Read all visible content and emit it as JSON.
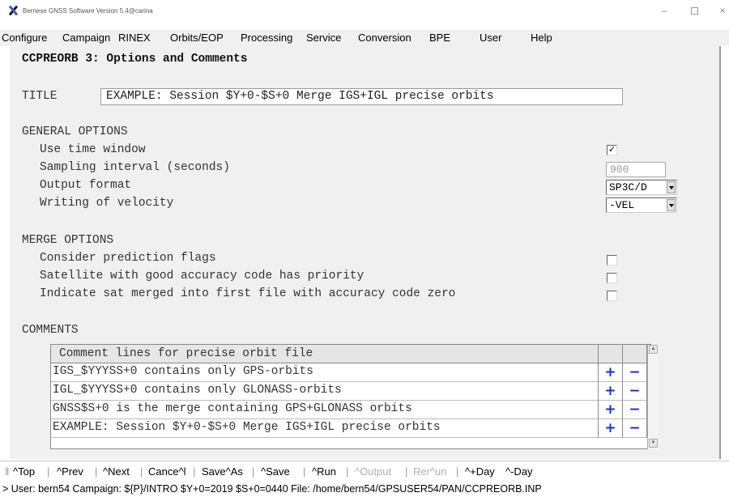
{
  "window": {
    "title": "Bernese GNSS Software Version 5.4@carina",
    "controls": {
      "minimize": "–",
      "maximize": "□",
      "close": "×"
    }
  },
  "menu": [
    "Configure",
    "Campaign",
    "RINEX",
    "Orbits/EOP",
    "Processing",
    "Service",
    "Conversion",
    "BPE",
    "User",
    "Help"
  ],
  "panel": {
    "heading": "CCPREORB 3: Options and Comments",
    "title_label": "TITLE",
    "title_value": "EXAMPLE: Session $Y+0-$S+0 Merge IGS+IGL precise orbits",
    "general": {
      "heading": "GENERAL OPTIONS",
      "use_time_window": {
        "label": "Use time window",
        "checked": true,
        "mark": "✓"
      },
      "sampling": {
        "label": "Sampling interval (seconds)",
        "value": "900"
      },
      "output_format": {
        "label": "Output format",
        "value": "SP3C/D"
      },
      "velocity": {
        "label": "Writing of velocity",
        "value": "-VEL"
      }
    },
    "merge": {
      "heading": "MERGE OPTIONS",
      "options": [
        {
          "label": "Consider prediction flags",
          "checked": false
        },
        {
          "label": "Satellite with good accuracy code has priority",
          "checked": false
        },
        {
          "label": "Indicate sat merged into first file with accuracy code zero",
          "checked": false
        }
      ]
    },
    "comments": {
      "heading": "COMMENTS",
      "table_header": "Comment lines for precise orbit file",
      "rows": [
        "IGS_$YYYSS+0 contains only GPS-orbits",
        "IGL_$YYYSS+0 contains only GLONASS-orbits",
        "GNSS$S+0 is the merge containing GPS+GLONASS orbits",
        "EXAMPLE: Session $Y+0-$S+0 Merge IGS+IGL precise orbits"
      ],
      "add_symbol": "+",
      "remove_symbol": "−"
    }
  },
  "toolbar": [
    "^Top",
    "^Prev",
    "^Next",
    "Cance^l",
    "Save^As",
    "^Save",
    "^Run",
    "^Output",
    "Rer^un",
    "^+Day",
    "^-Day"
  ],
  "toolbar_disabled": [
    "^Output",
    "Rer^un"
  ],
  "status": "> User: bern54  Campaign: ${P}/INTRO  $Y+0=2019  $S+0=0440  File: /home/bern54/GPSUSER54/PAN/CCPREORB.INP",
  "colors": {
    "panel_bg": "#f0f0f0",
    "accent_blue": "#1433c8"
  }
}
